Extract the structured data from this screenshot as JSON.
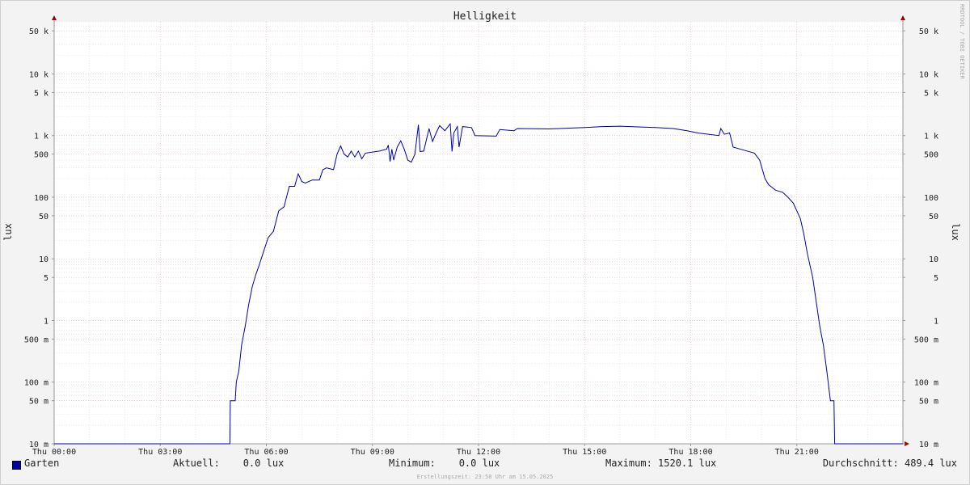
{
  "chart_data": {
    "type": "line",
    "title": "Helligkeit",
    "ylabel": "lux",
    "ylabel_right": "lux",
    "yscale": "log",
    "ylim": [
      0.01,
      70000
    ],
    "xlim": [
      0,
      24
    ],
    "x_ticks": [
      {
        "x": 0,
        "label": "Thu 00:00"
      },
      {
        "x": 3,
        "label": "Thu 03:00"
      },
      {
        "x": 6,
        "label": "Thu 06:00"
      },
      {
        "x": 9,
        "label": "Thu 09:00"
      },
      {
        "x": 12,
        "label": "Thu 12:00"
      },
      {
        "x": 15,
        "label": "Thu 15:00"
      },
      {
        "x": 18,
        "label": "Thu 18:00"
      },
      {
        "x": 21,
        "label": "Thu 21:00"
      }
    ],
    "y_ticks": [
      {
        "v": 50000,
        "label": "50 k"
      },
      {
        "v": 10000,
        "label": "10 k"
      },
      {
        "v": 5000,
        "label": "5 k"
      },
      {
        "v": 1000,
        "label": "1 k"
      },
      {
        "v": 500,
        "label": "500"
      },
      {
        "v": 100,
        "label": "100"
      },
      {
        "v": 50,
        "label": "50"
      },
      {
        "v": 10,
        "label": "10"
      },
      {
        "v": 5,
        "label": "5"
      },
      {
        "v": 1,
        "label": "1"
      },
      {
        "v": 0.5,
        "label": "500 m"
      },
      {
        "v": 0.1,
        "label": "100 m"
      },
      {
        "v": 0.05,
        "label": "50 m"
      },
      {
        "v": 0.01,
        "label": "10 m"
      }
    ],
    "grid": true,
    "series": [
      {
        "name": "Garten",
        "color": "#0000aa",
        "points": [
          [
            0,
            0.01
          ],
          [
            4.97,
            0.01
          ],
          [
            4.98,
            0.05
          ],
          [
            5.12,
            0.05
          ],
          [
            5.15,
            0.1
          ],
          [
            5.22,
            0.15
          ],
          [
            5.3,
            0.4
          ],
          [
            5.4,
            0.8
          ],
          [
            5.5,
            1.8
          ],
          [
            5.6,
            3.5
          ],
          [
            5.7,
            5.5
          ],
          [
            5.8,
            8
          ],
          [
            5.9,
            12
          ],
          [
            6.05,
            22
          ],
          [
            6.2,
            28
          ],
          [
            6.35,
            60
          ],
          [
            6.5,
            70
          ],
          [
            6.65,
            150
          ],
          [
            6.8,
            150
          ],
          [
            6.9,
            240
          ],
          [
            7.0,
            180
          ],
          [
            7.1,
            170
          ],
          [
            7.3,
            190
          ],
          [
            7.5,
            190
          ],
          [
            7.6,
            280
          ],
          [
            7.7,
            300
          ],
          [
            7.9,
            280
          ],
          [
            8.0,
            500
          ],
          [
            8.1,
            680
          ],
          [
            8.2,
            500
          ],
          [
            8.3,
            450
          ],
          [
            8.4,
            560
          ],
          [
            8.5,
            450
          ],
          [
            8.6,
            560
          ],
          [
            8.7,
            420
          ],
          [
            8.8,
            520
          ],
          [
            9.0,
            540
          ],
          [
            9.2,
            560
          ],
          [
            9.4,
            600
          ],
          [
            9.45,
            700
          ],
          [
            9.5,
            380
          ],
          [
            9.55,
            600
          ],
          [
            9.6,
            400
          ],
          [
            9.7,
            650
          ],
          [
            9.8,
            820
          ],
          [
            9.9,
            600
          ],
          [
            10.0,
            400
          ],
          [
            10.1,
            370
          ],
          [
            10.2,
            500
          ],
          [
            10.3,
            1500
          ],
          [
            10.35,
            550
          ],
          [
            10.45,
            560
          ],
          [
            10.6,
            1300
          ],
          [
            10.7,
            800
          ],
          [
            10.8,
            1100
          ],
          [
            10.9,
            1450
          ],
          [
            11.05,
            1200
          ],
          [
            11.2,
            1550
          ],
          [
            11.25,
            550
          ],
          [
            11.3,
            1100
          ],
          [
            11.4,
            1400
          ],
          [
            11.45,
            650
          ],
          [
            11.55,
            1400
          ],
          [
            11.8,
            1350
          ],
          [
            11.9,
            1000
          ],
          [
            12.5,
            980
          ],
          [
            12.6,
            1250
          ],
          [
            13.0,
            1200
          ],
          [
            13.1,
            1300
          ],
          [
            14.0,
            1280
          ],
          [
            15.0,
            1350
          ],
          [
            15.5,
            1400
          ],
          [
            16.0,
            1420
          ],
          [
            16.5,
            1380
          ],
          [
            17.0,
            1350
          ],
          [
            17.5,
            1300
          ],
          [
            17.9,
            1200
          ],
          [
            18.2,
            1100
          ],
          [
            18.5,
            1050
          ],
          [
            18.8,
            1000
          ],
          [
            18.85,
            1300
          ],
          [
            18.95,
            1050
          ],
          [
            19.1,
            1100
          ],
          [
            19.2,
            650
          ],
          [
            19.5,
            580
          ],
          [
            19.8,
            520
          ],
          [
            19.95,
            400
          ],
          [
            20.1,
            200
          ],
          [
            20.2,
            160
          ],
          [
            20.4,
            130
          ],
          [
            20.6,
            120
          ],
          [
            20.75,
            100
          ],
          [
            20.9,
            80
          ],
          [
            21.0,
            60
          ],
          [
            21.1,
            45
          ],
          [
            21.2,
            25
          ],
          [
            21.3,
            12
          ],
          [
            21.45,
            5
          ],
          [
            21.55,
            2
          ],
          [
            21.65,
            0.8
          ],
          [
            21.75,
            0.4
          ],
          [
            21.85,
            0.15
          ],
          [
            21.95,
            0.05
          ],
          [
            22.05,
            0.05
          ],
          [
            22.07,
            0.01
          ],
          [
            24,
            0.01
          ]
        ]
      }
    ],
    "legend": {
      "series_label": "Garten",
      "aktuell": "Aktuell:    0.0 lux",
      "minimum": "Minimum:    0.0 lux",
      "maximum": "Maximum: 1520.1 lux",
      "durchschnitt": "Durchschnitt: 489.4 lux"
    },
    "watermark": "RRDTOOL / TOBI OETIKER",
    "footer": "Erstellungszeit: 23:58 Uhr am 15.05.2025"
  }
}
